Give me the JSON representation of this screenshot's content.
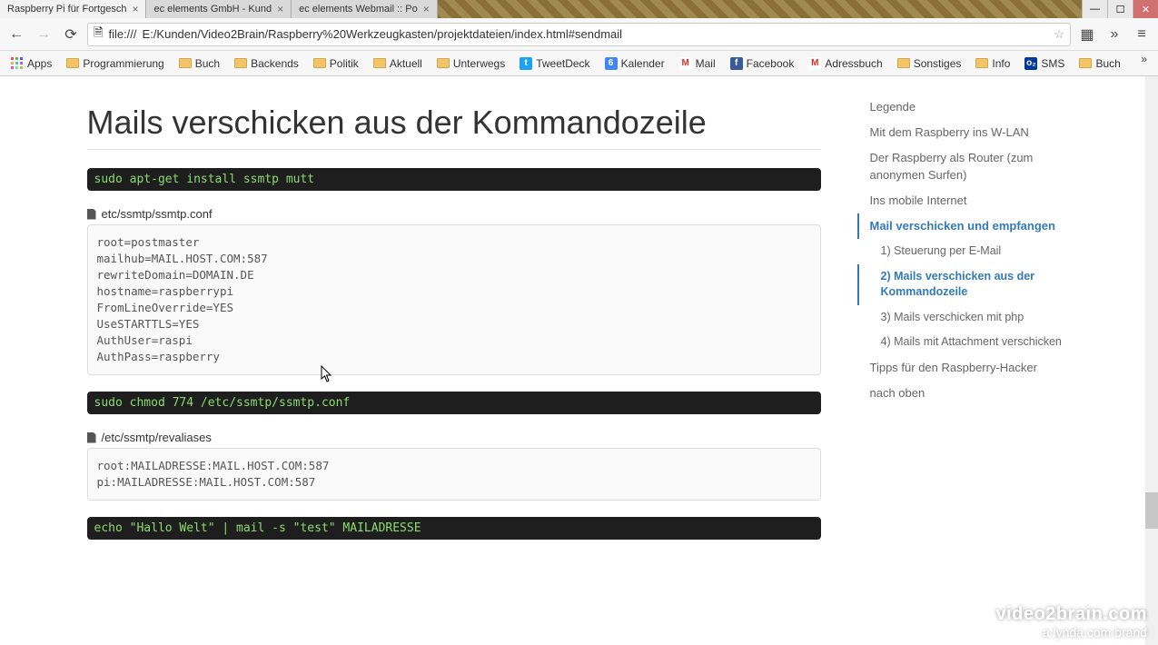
{
  "window": {
    "tabs": [
      {
        "title": "Raspberry Pi für Fortgesch",
        "active": true
      },
      {
        "title": "ec elements GmbH - Kund",
        "active": false
      },
      {
        "title": "ec elements Webmail :: Po",
        "active": false
      }
    ]
  },
  "nav": {
    "url_prefix": "file:///",
    "url_path": "E:/Kunden/Video2Brain/Raspberry%20Werkzeugkasten/projektdateien/index.html#sendmail"
  },
  "bookmarks": [
    {
      "kind": "apps",
      "label": "Apps"
    },
    {
      "kind": "folder",
      "label": "Programmierung"
    },
    {
      "kind": "folder",
      "label": "Buch"
    },
    {
      "kind": "folder",
      "label": "Backends"
    },
    {
      "kind": "folder",
      "label": "Politik"
    },
    {
      "kind": "folder",
      "label": "Aktuell"
    },
    {
      "kind": "folder",
      "label": "Unterwegs"
    },
    {
      "kind": "icon",
      "label": "TweetDeck",
      "bg": "#1da1f2",
      "fg": "#fff",
      "glyph": "t"
    },
    {
      "kind": "icon",
      "label": "Kalender",
      "bg": "#4285f4",
      "fg": "#fff",
      "glyph": "6"
    },
    {
      "kind": "icon",
      "label": "Mail",
      "bg": "#fff",
      "fg": "#d93025",
      "glyph": "M"
    },
    {
      "kind": "icon",
      "label": "Facebook",
      "bg": "#3b5998",
      "fg": "#fff",
      "glyph": "f"
    },
    {
      "kind": "icon",
      "label": "Adressbuch",
      "bg": "#fff",
      "fg": "#d93025",
      "glyph": "M"
    },
    {
      "kind": "folder",
      "label": "Sonstiges"
    },
    {
      "kind": "folder",
      "label": "Info"
    },
    {
      "kind": "icon",
      "label": "SMS",
      "bg": "#003a9b",
      "fg": "#fff",
      "glyph": "o₂"
    },
    {
      "kind": "folder",
      "label": "Buch"
    }
  ],
  "article": {
    "heading": "Mails verschicken aus der Kommandozeile",
    "cmd1": "sudo apt-get install ssmtp mutt",
    "file1_label": "etc/ssmtp/ssmtp.conf",
    "file1_body": "root=postmaster\nmailhub=MAIL.HOST.COM:587\nrewriteDomain=DOMAIN.DE\nhostname=raspberrypi\nFromLineOverride=YES\nUseSTARTTLS=YES\nAuthUser=raspi\nAuthPass=raspberry",
    "cmd2": "sudo chmod 774 /etc/ssmtp/ssmtp.conf",
    "file2_label": "/etc/ssmtp/revaliases",
    "file2_body": "root:MAILADRESSE:MAIL.HOST.COM:587\npi:MAILADRESSE:MAIL.HOST.COM:587",
    "cmd3": "echo \"Hallo Welt\" | mail -s \"test\" MAILADRESSE"
  },
  "sidebar": {
    "items": [
      {
        "label": "Legende"
      },
      {
        "label": "Mit dem Raspberry ins W-LAN"
      },
      {
        "label": "Der Raspberry als Router (zum anonymen Surfen)"
      },
      {
        "label": "Ins mobile Internet"
      },
      {
        "label": "Mail verschicken und empfangen",
        "active": true,
        "subs": [
          {
            "label": "1) Steuerung per E-Mail"
          },
          {
            "label": "2) Mails verschicken aus der Kommandozeile",
            "active": true
          },
          {
            "label": "3) Mails verschicken mit php"
          },
          {
            "label": "4) Mails mit Attachment verschicken"
          }
        ]
      },
      {
        "label": "Tipps für den Raspberry-Hacker"
      },
      {
        "label": "nach oben"
      }
    ]
  },
  "watermark": {
    "line1": "video2brain.com",
    "line2": "a lynda.com brand"
  }
}
